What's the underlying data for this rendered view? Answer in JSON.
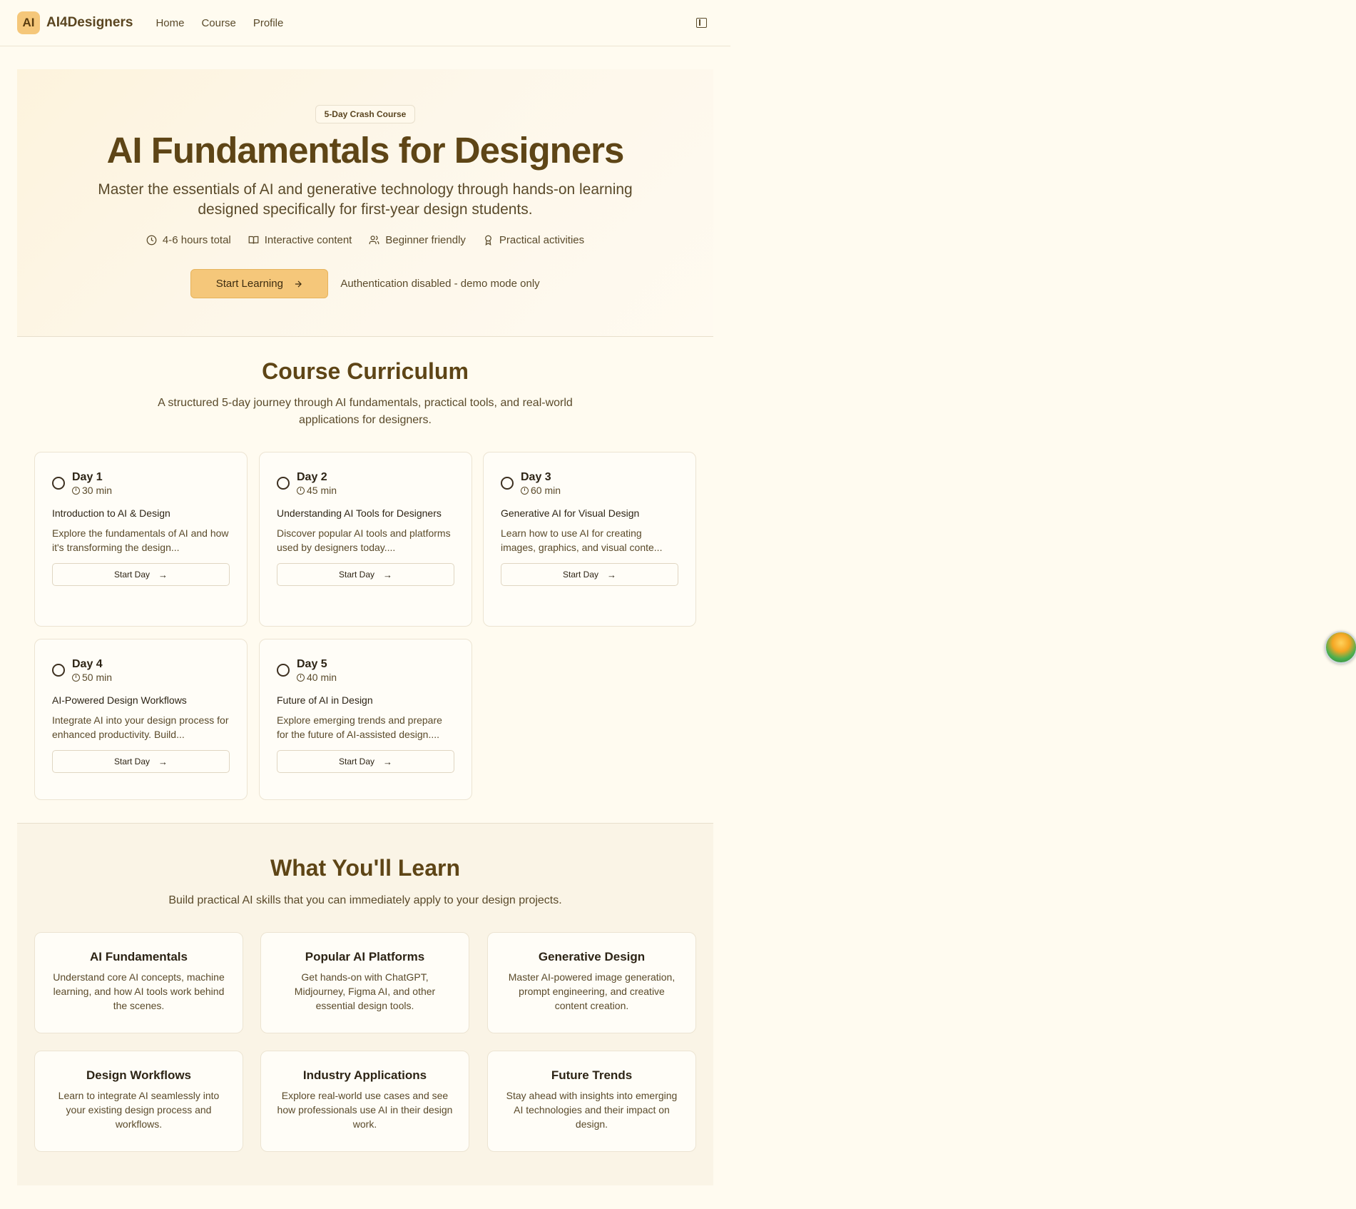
{
  "nav": {
    "logo_text": "AI",
    "brand": "AI4Designers",
    "links": [
      "Home",
      "Course",
      "Profile"
    ]
  },
  "hero": {
    "badge": "5-Day Crash Course",
    "title": "AI Fundamentals for Designers",
    "subtitle": "Master the essentials of AI and generative technology through hands-on learning designed specifically for first-year design students.",
    "features": [
      {
        "icon": "clock-icon",
        "label": "4-6 hours total"
      },
      {
        "icon": "book-icon",
        "label": "Interactive content"
      },
      {
        "icon": "users-icon",
        "label": "Beginner friendly"
      },
      {
        "icon": "award-icon",
        "label": "Practical activities"
      }
    ],
    "cta_label": "Start Learning",
    "auth_note": "Authentication disabled - demo mode only"
  },
  "curriculum": {
    "title": "Course Curriculum",
    "subtitle": "A structured 5-day journey through AI fundamentals, practical tools, and real-world applications for designers.",
    "days": [
      {
        "day": "Day 1",
        "time": "30 min",
        "title": "Introduction to AI & Design",
        "desc": "Explore the fundamentals of AI and how it's transforming the design...",
        "button": "Start Day"
      },
      {
        "day": "Day 2",
        "time": "45 min",
        "title": "Understanding AI Tools for Designers",
        "desc": "Discover popular AI tools and platforms used by designers today....",
        "button": "Start Day"
      },
      {
        "day": "Day 3",
        "time": "60 min",
        "title": "Generative AI for Visual Design",
        "desc": "Learn how to use AI for creating images, graphics, and visual conte...",
        "button": "Start Day"
      },
      {
        "day": "Day 4",
        "time": "50 min",
        "title": "AI-Powered Design Workflows",
        "desc": "Integrate AI into your design process for enhanced productivity. Build...",
        "button": "Start Day"
      },
      {
        "day": "Day 5",
        "time": "40 min",
        "title": "Future of AI in Design",
        "desc": "Explore emerging trends and prepare for the future of AI-assisted design....",
        "button": "Start Day"
      }
    ]
  },
  "learn": {
    "title": "What You'll Learn",
    "subtitle": "Build practical AI skills that you can immediately apply to your design projects.",
    "cards": [
      {
        "title": "AI Fundamentals",
        "desc": "Understand core AI concepts, machine learning, and how AI tools work behind the scenes."
      },
      {
        "title": "Popular AI Platforms",
        "desc": "Get hands-on with ChatGPT, Midjourney, Figma AI, and other essential design tools."
      },
      {
        "title": "Generative Design",
        "desc": "Master AI-powered image generation, prompt engineering, and creative content creation."
      },
      {
        "title": "Design Workflows",
        "desc": "Learn to integrate AI seamlessly into your existing design process and workflows."
      },
      {
        "title": "Industry Applications",
        "desc": "Explore real-world use cases and see how professionals use AI in their design work."
      },
      {
        "title": "Future Trends",
        "desc": "Stay ahead with insights into emerging AI technologies and their impact on design."
      }
    ]
  }
}
